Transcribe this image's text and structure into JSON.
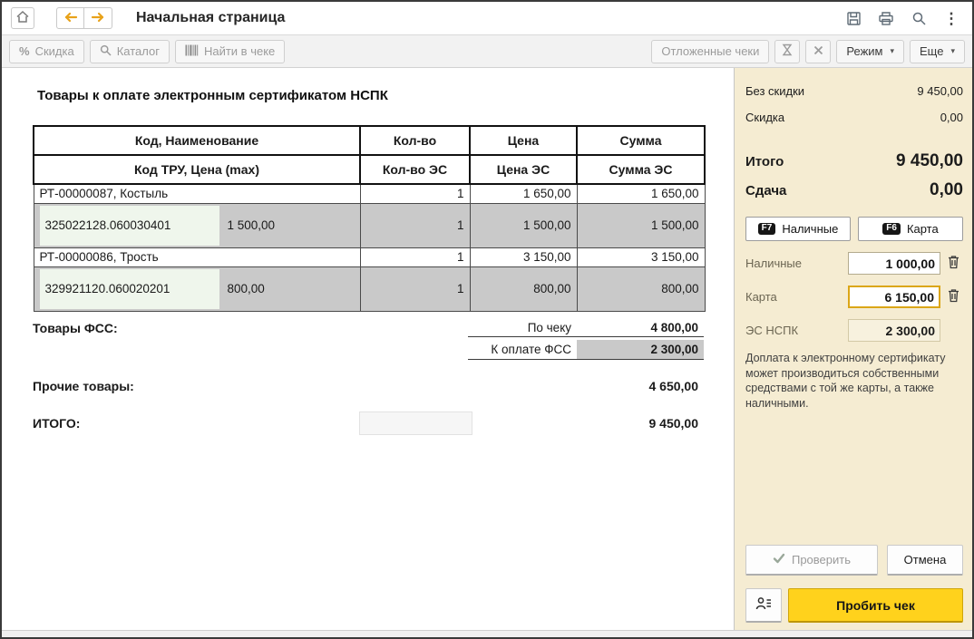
{
  "window": {
    "title": "Начальная страница"
  },
  "icons": {
    "percent": "%",
    "caret": "▾",
    "dots": "⋮"
  },
  "toolbar": {
    "discount_label": "Скидка",
    "catalog_label": "Каталог",
    "find_in_receipt_label": "Найти в чеке",
    "deferred_label": "Отложенные чеки",
    "mode_label": "Режим",
    "more_label": "Еще"
  },
  "receipt": {
    "heading": "Товары к оплате электронным сертификатом НСПК",
    "table": {
      "header_row1": [
        "Код, Наименование",
        "Кол-во",
        "Цена",
        "Сумма"
      ],
      "header_row2": [
        "Код ТРУ, Цена (max)",
        "Кол-во ЭС",
        "Цена ЭС",
        "Сумма ЭС"
      ],
      "rows": [
        {
          "name": "РТ-00000087, Костыль",
          "qty": "1",
          "price": "1 650,00",
          "sum": "1 650,00"
        },
        {
          "code": "325022128.060030401",
          "max_price": "1 500,00",
          "qty": "1",
          "price": "1 500,00",
          "sum": "1 500,00"
        },
        {
          "name": "РТ-00000086, Трость",
          "qty": "1",
          "price": "3 150,00",
          "sum": "3 150,00"
        },
        {
          "code": "329921120.060020201",
          "max_price": "800,00",
          "qty": "1",
          "price": "800,00",
          "sum": "800,00"
        }
      ]
    },
    "totals": {
      "fss_label": "Товары ФСС:",
      "by_receipt_label": "По чеку",
      "by_receipt_value": "4 800,00",
      "fss_due_label": "К оплате ФСС",
      "fss_due_value": "2 300,00",
      "other_label": "Прочие товары:",
      "other_value": "4 650,00",
      "grand_label": "ИТОГО:",
      "grand_value": "9 450,00"
    }
  },
  "payment": {
    "no_discount_label": "Без скидки",
    "no_discount_value": "9 450,00",
    "discount_label": "Скидка",
    "discount_value": "0,00",
    "total_label": "Итого",
    "total_value": "9 450,00",
    "change_label": "Сдача",
    "change_value": "0,00",
    "cash_button": {
      "key": "F7",
      "label": "Наличные"
    },
    "card_button": {
      "key": "F6",
      "label": "Карта"
    },
    "cash_field": {
      "label": "Наличные",
      "value": "1 000,00"
    },
    "card_field": {
      "label": "Карта",
      "value": "6 150,00"
    },
    "es_field": {
      "label": "ЭС НСПК",
      "value": "2 300,00"
    },
    "hint": "Доплата к электронному сертификату может производиться собственными средствами с той же карты, а также наличными.",
    "check_button": "Проверить",
    "cancel_button": "Отмена",
    "submit_button": "Пробить чек"
  }
}
